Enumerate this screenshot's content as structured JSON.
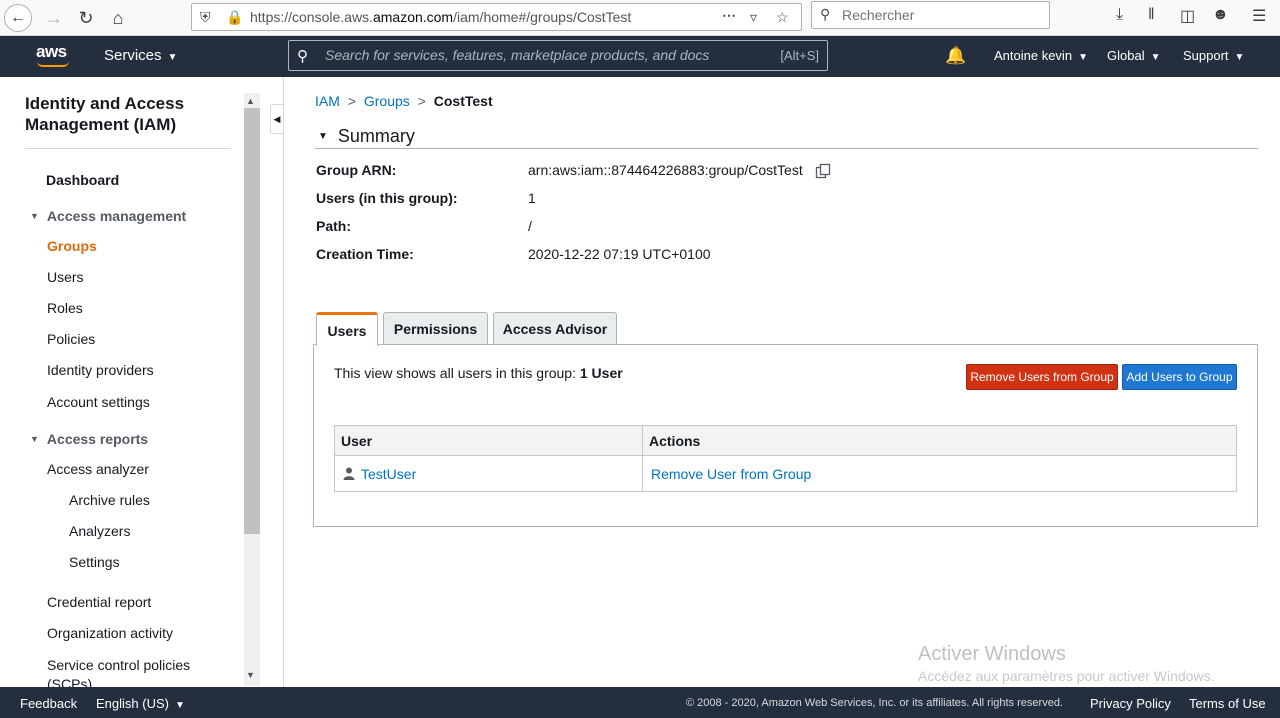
{
  "browser": {
    "url_prefix": "https://console.aws.",
    "url_domain": "amazon.com",
    "url_path": "/iam/home#/groups/CostTest",
    "find_placeholder": "Rechercher"
  },
  "topnav": {
    "logo": "aws",
    "services_label": "Services",
    "search_placeholder": "Search for services, features, marketplace products, and docs",
    "search_shortcut": "[Alt+S]",
    "account_label": "Antoine kevin",
    "region_label": "Global",
    "support_label": "Support"
  },
  "sidebar": {
    "title": "Identity and Access Management (IAM)",
    "dashboard": "Dashboard",
    "access_management": "Access management",
    "items_am": [
      "Groups",
      "Users",
      "Roles",
      "Policies",
      "Identity providers",
      "Account settings"
    ],
    "access_reports": "Access reports",
    "access_analyzer": "Access analyzer",
    "analyzer_items": [
      "Archive rules",
      "Analyzers",
      "Settings"
    ],
    "bottom_items": [
      "Credential report",
      "Organization activity",
      "Service control policies (SCPs)"
    ]
  },
  "breadcrumb": {
    "iam": "IAM",
    "sep1": ">",
    "groups": "Groups",
    "sep2": ">",
    "current": "CostTest"
  },
  "summary": {
    "heading": "Summary",
    "rows": [
      {
        "label": "Group ARN:",
        "value": "arn:aws:iam::874464226883:group/CostTest"
      },
      {
        "label": "Users (in this group):",
        "value": "1"
      },
      {
        "label": "Path:",
        "value": "/"
      },
      {
        "label": "Creation Time:",
        "value": "2020-12-22 07:19 UTC+0100"
      }
    ]
  },
  "tabs": [
    "Users",
    "Permissions",
    "Access Advisor"
  ],
  "users_panel": {
    "info_text": "This view shows all users in this group: ",
    "info_count": "1 User",
    "remove_button": "Remove Users from Group",
    "add_button": "Add Users to Group",
    "columns": [
      "User",
      "Actions"
    ],
    "rows": [
      {
        "user": "TestUser",
        "action": "Remove User from Group"
      }
    ]
  },
  "watermark": {
    "line1": "Activer Windows",
    "line2": "Accédez aux paramètres pour activer Windows."
  },
  "footer": {
    "feedback": "Feedback",
    "language": "English (US)",
    "copyright": "© 2008 - 2020, Amazon Web Services, Inc. or its affiliates. All rights reserved.",
    "privacy": "Privacy Policy",
    "terms": "Terms of Use"
  },
  "colors": {
    "nav_bg": "#232f3e",
    "accent_orange": "#ec7211",
    "active_nav": "#dd6b10",
    "link_blue": "#0073bb",
    "danger_red": "#d13212",
    "primary_blue": "#1f78d1"
  }
}
